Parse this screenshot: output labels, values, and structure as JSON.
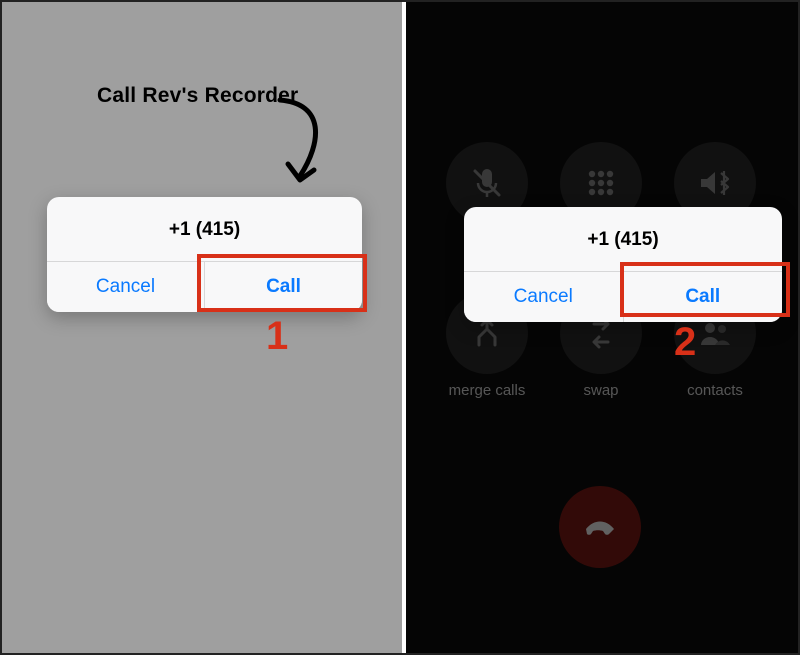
{
  "annotation": {
    "label": "Call Rev's Recorder",
    "steps": {
      "one": "1",
      "two": "2"
    }
  },
  "left": {
    "alert": {
      "title": "+1 (415)",
      "cancel_label": "Cancel",
      "call_label": "Call"
    }
  },
  "right": {
    "alert": {
      "title": "+1 (415)",
      "cancel_label": "Cancel",
      "call_label": "Call"
    },
    "controls_row1": {
      "mute_label": "",
      "keypad_label": "",
      "audio_label": ""
    },
    "controls_row2": {
      "merge_label": "merge calls",
      "swap_label": "swap",
      "contacts_label": "contacts"
    }
  },
  "colors": {
    "accent": "#0a7aff",
    "highlight": "#d83018",
    "end_call": "#7e1b14"
  }
}
